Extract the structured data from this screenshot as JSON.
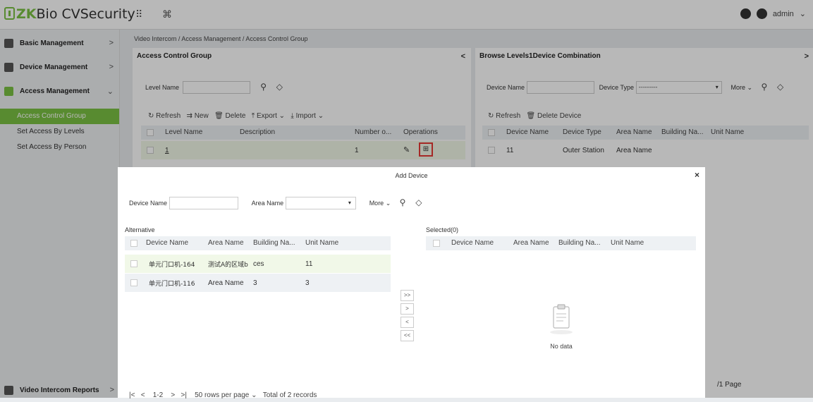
{
  "topbar": {
    "logo_zk": "ZK",
    "logo_rest": "Bio CVSecurity",
    "apps_icon": "⠿",
    "cmd_icon": "⌘",
    "user": "admin"
  },
  "sidebar": {
    "menus": [
      {
        "label": "Basic Management",
        "chevron": ">"
      },
      {
        "label": "Device Management",
        "chevron": ">"
      },
      {
        "label": "Access Management",
        "chevron": "⌄"
      }
    ],
    "sub_items": [
      "Access Control Group",
      "Set Access By Levels",
      "Set Access By Person"
    ],
    "bottom_menu": {
      "label": "Video Intercom Reports",
      "chevron": ">"
    }
  },
  "breadcrumb": "Video Intercom / Access Management / Access Control Group",
  "left_panel": {
    "title": "Access Control Group",
    "collapse": "<",
    "search_label": "Level Name",
    "toolbar": [
      "Refresh",
      "New",
      "Delete",
      "Export",
      "Import"
    ],
    "columns": [
      "Level Name",
      "Description",
      "Number o...",
      "Operations"
    ],
    "rows": [
      {
        "level_name": "1",
        "description": "",
        "number": "1"
      }
    ]
  },
  "right_panel": {
    "title": "Browse Levels1Device Combination",
    "expand": ">",
    "device_name_label": "Device Name",
    "device_type_label": "Device Type",
    "device_type_value": "----------",
    "more": "More",
    "toolbar": [
      "Refresh",
      "Delete Device"
    ],
    "columns": [
      "Device Name",
      "Device Type",
      "Area Name",
      "Building Na...",
      "Unit Name"
    ],
    "rows": [
      {
        "device_name": "11",
        "device_type": "Outer Station",
        "area_name": "Area Name"
      }
    ],
    "pages": "/1 Page"
  },
  "modal": {
    "title": "Add Device",
    "close": "×",
    "device_name_label": "Device Name",
    "area_name_label": "Area Name",
    "more": "More",
    "alternative_label": "Alternative",
    "selected_label": "Selected(0)",
    "columns": [
      "Device Name",
      "Area Name",
      "Building Na...",
      "Unit Name"
    ],
    "alt_rows": [
      {
        "device_name": "单元门口机-164",
        "area_name": "测试A的区域b",
        "building": "ces",
        "unit": "11"
      },
      {
        "device_name": "单元门口机-116",
        "area_name": "Area Name",
        "building": "3",
        "unit": "3"
      }
    ],
    "transfer_buttons": [
      ">>",
      ">",
      "<",
      "<<"
    ],
    "no_data": "No data",
    "pagination": {
      "range": "1-2",
      "rows_per_page": "50 rows per page",
      "total": "Total of 2 records"
    }
  }
}
